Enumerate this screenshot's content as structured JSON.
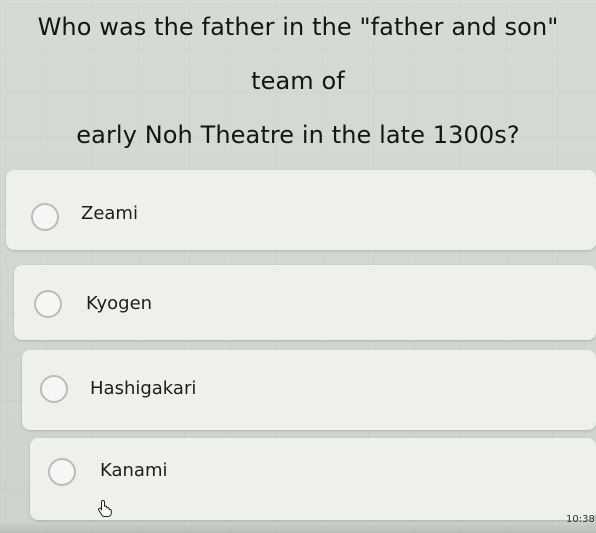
{
  "question": "Who was the father in the \"father and son\" team of\nearly Noh Theatre in the late 1300s?",
  "options": [
    {
      "label": "Zeami"
    },
    {
      "label": "Kyogen"
    },
    {
      "label": "Hashigakari"
    },
    {
      "label": "Kanami"
    }
  ],
  "status": {
    "time": "10:38"
  },
  "colors": {
    "background": "#d2d8cf",
    "card": "#eef0ec",
    "text": "#151515"
  },
  "icons": {
    "radio": "radio-button-icon",
    "cursor": "hand-cursor-icon"
  }
}
